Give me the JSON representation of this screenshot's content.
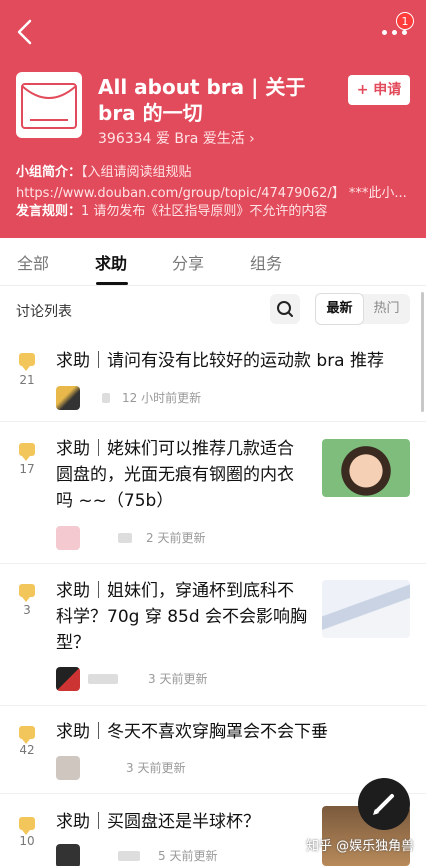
{
  "topbar": {
    "notification_count": "1"
  },
  "group": {
    "title": "All about bra | 关于 bra 的一切",
    "meta": "396334 爱 Bra 爱生活 ›",
    "apply_label": "+ 申请",
    "intro_label": "小组简介：",
    "intro_text": "【入组请阅读组规贴 https://www.douban.com/group/topic/47479062/】 ***此小...",
    "rules_label": "发言规则：",
    "rules_text": "1 请勿发布《社区指导原则》不允许的内容"
  },
  "tabs": [
    "全部",
    "求助",
    "分享",
    "组务"
  ],
  "list": {
    "title": "讨论列表",
    "sort_options": [
      "最新",
      "热门"
    ]
  },
  "posts": [
    {
      "count": "21",
      "title": "求助｜请问有没有比较好的运动款 bra 推荐",
      "time": "12 小时前更新"
    },
    {
      "count": "17",
      "title": "求助｜姥妹们可以推荐几款适合圆盘的，光面无痕有钢圈的内衣吗 ~~（75b）",
      "time": "2 天前更新"
    },
    {
      "count": "3",
      "title": "求助｜姐妹们，穿通杯到底科不科学？70g 穿 85d 会不会影响胸型？",
      "time": "3 天前更新"
    },
    {
      "count": "42",
      "title": "求助｜冬天不喜欢穿胸罩会不会下垂",
      "time": "3 天前更新"
    },
    {
      "count": "10",
      "title": "求助｜买圆盘还是半球杯？",
      "time": "5 天前更新"
    }
  ],
  "watermark": "知乎 @娱乐独角兽",
  "colors": {
    "brand": "#e24b5b",
    "bubble": "#f3c65b"
  }
}
